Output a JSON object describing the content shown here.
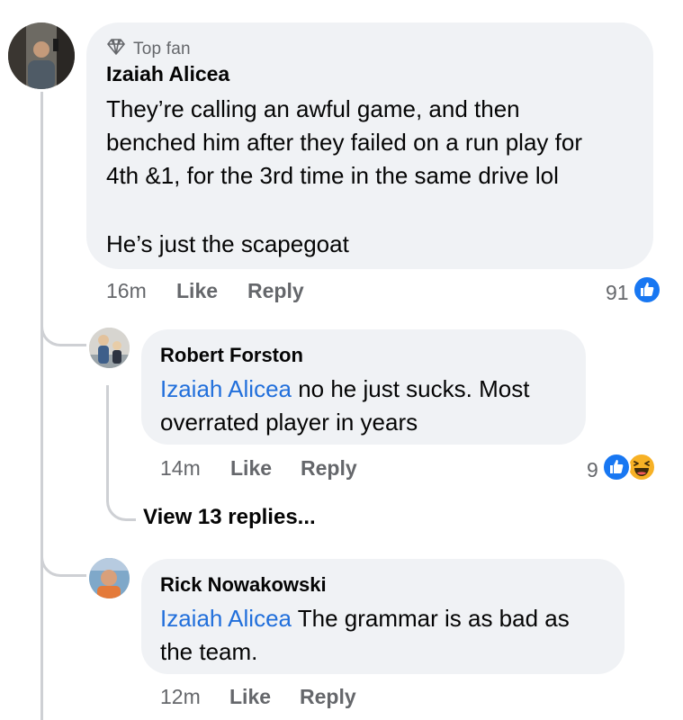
{
  "comment": {
    "badge": "Top fan",
    "author": "Izaiah Alicea",
    "text_line1": "They’re calling an awful game, and then",
    "text_line2": "benched him after they failed on a run play for",
    "text_line3": "4th &1, for the 3rd time in the same drive lol",
    "text_line4": "He’s just the scapegoat",
    "time": "16m",
    "like_label": "Like",
    "reply_label": "Reply",
    "reaction_count": "91",
    "reaction_icons": [
      "like-icon"
    ]
  },
  "replies": [
    {
      "author": "Robert Forston",
      "mention": "Izaiah Alicea",
      "text_line1": " no he just sucks. Most",
      "text_line2": "overrated player in years",
      "time": "14m",
      "like_label": "Like",
      "reply_label": "Reply",
      "reaction_count": "9",
      "reaction_icons": [
        "like-icon",
        "haha-icon"
      ],
      "view_replies": "View 13 replies..."
    },
    {
      "author": "Rick Nowakowski",
      "mention": "Izaiah Alicea",
      "text_line1": " The grammar is as bad as",
      "text_line2": "the team.",
      "time": "12m",
      "like_label": "Like",
      "reply_label": "Reply"
    }
  ],
  "colors": {
    "bubble": "#f0f2f5",
    "mention": "#216fdb",
    "meta": "#65676b",
    "like_blue": "#1877f2",
    "haha_yellow": "#f7b125",
    "thread_line": "#ced0d4"
  }
}
